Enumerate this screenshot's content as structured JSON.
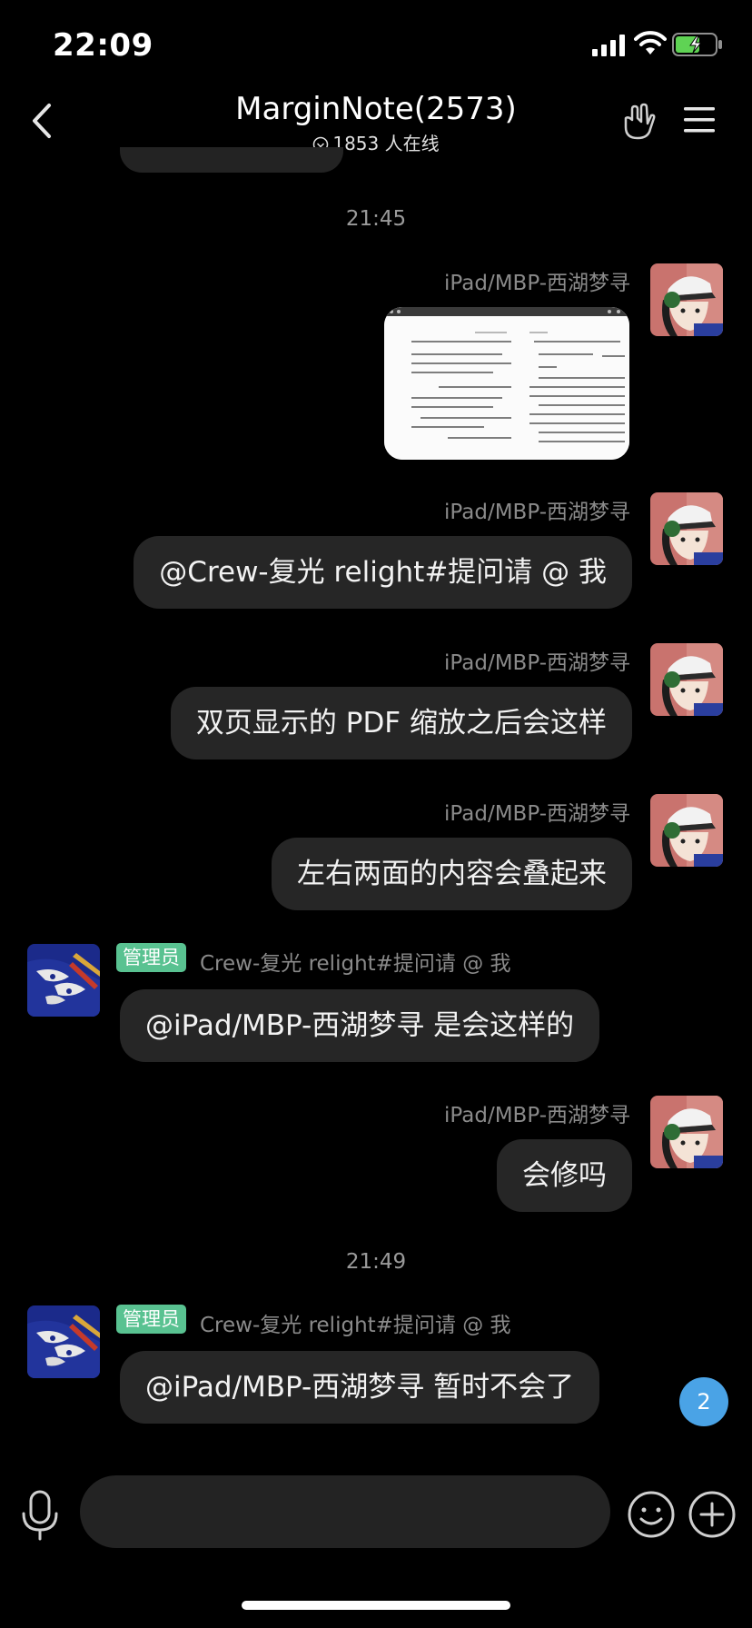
{
  "status_bar": {
    "time": "22:09"
  },
  "header": {
    "title": "MarginNote(2573)",
    "online": "1853 人在线"
  },
  "messages": [
    {
      "timestamp": "21:45"
    },
    {
      "sender": "iPad/MBP-西湖梦寻",
      "type": "image"
    },
    {
      "sender": "iPad/MBP-西湖梦寻",
      "text": "@Crew-复光 relight#提问请 @ 我"
    },
    {
      "sender": "iPad/MBP-西湖梦寻",
      "text": "双页显示的 PDF 缩放之后会这样"
    },
    {
      "sender": "iPad/MBP-西湖梦寻",
      "text": "左右两面的内容会叠起来"
    },
    {
      "badge": "管理员",
      "sender": "Crew-复光 relight#提问请 @ 我",
      "text": "@iPad/MBP-西湖梦寻 是会这样的"
    },
    {
      "sender": "iPad/MBP-西湖梦寻",
      "text": "会修吗"
    },
    {
      "timestamp": "21:49"
    },
    {
      "badge": "管理员",
      "sender": "Crew-复光 relight#提问请 @ 我",
      "text": "@iPad/MBP-西湖梦寻 暂时不会了"
    }
  ],
  "unread_count": "2",
  "input": {
    "value": ""
  },
  "icons": {
    "back": "chevron-left-icon",
    "hand": "hand-icon",
    "menu": "hamburger-menu-icon",
    "voice": "microphone-icon",
    "emoji": "smiley-icon",
    "plus": "plus-icon"
  },
  "colors": {
    "background": "#000000",
    "bubble": "#262626",
    "admin_badge": "#59c291",
    "unread_badge": "#4aa3e6"
  }
}
